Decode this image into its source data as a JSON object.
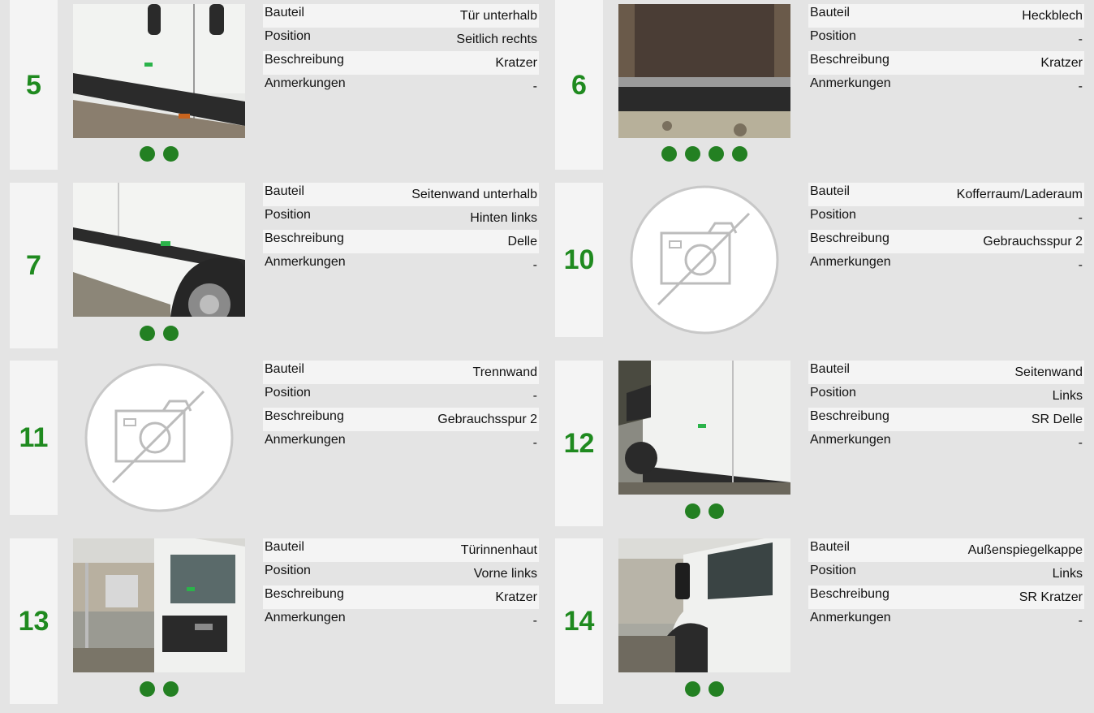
{
  "labels": {
    "bauteil": "Bauteil",
    "position": "Position",
    "beschreibung": "Beschreibung",
    "anmerkungen": "Anmerkungen"
  },
  "accent_color": "#1f8a1f",
  "damages": [
    {
      "number": "5",
      "bauteil": "Tür unterhalb",
      "position": "Seitlich rechts",
      "beschreibung": "Kratzer",
      "anmerkungen": "-",
      "photo": "van-side-door-lower",
      "dots": 2
    },
    {
      "number": "6",
      "bauteil": "Heckblech",
      "position": "-",
      "beschreibung": "Kratzer",
      "anmerkungen": "-",
      "photo": "cargo-floor-rear",
      "dots": 4
    },
    {
      "number": "7",
      "bauteil": "Seitenwand unterhalb",
      "position": "Hinten links",
      "beschreibung": "Delle",
      "anmerkungen": "-",
      "photo": "van-side-wheel",
      "dots": 2
    },
    {
      "number": "10",
      "bauteil": "Kofferraum/Laderaum",
      "position": "-",
      "beschreibung": "Gebrauchsspur 2",
      "anmerkungen": "-",
      "photo": "no-photo",
      "dots": 0
    },
    {
      "number": "11",
      "bauteil": "Trennwand",
      "position": "-",
      "beschreibung": "Gebrauchsspur 2",
      "anmerkungen": "-",
      "photo": "no-photo",
      "dots": 0
    },
    {
      "number": "12",
      "bauteil": "Seitenwand",
      "position": "Links",
      "beschreibung": "SR Delle",
      "anmerkungen": "-",
      "photo": "van-side-panel",
      "dots": 2
    },
    {
      "number": "13",
      "bauteil": "Türinnenhaut",
      "position": "Vorne links",
      "beschreibung": "Kratzer",
      "anmerkungen": "-",
      "photo": "door-inner",
      "dots": 2
    },
    {
      "number": "14",
      "bauteil": "Außenspiegelkappe",
      "position": "Links",
      "beschreibung": "SR Kratzer",
      "anmerkungen": "-",
      "photo": "mirror-cap",
      "dots": 2
    }
  ]
}
